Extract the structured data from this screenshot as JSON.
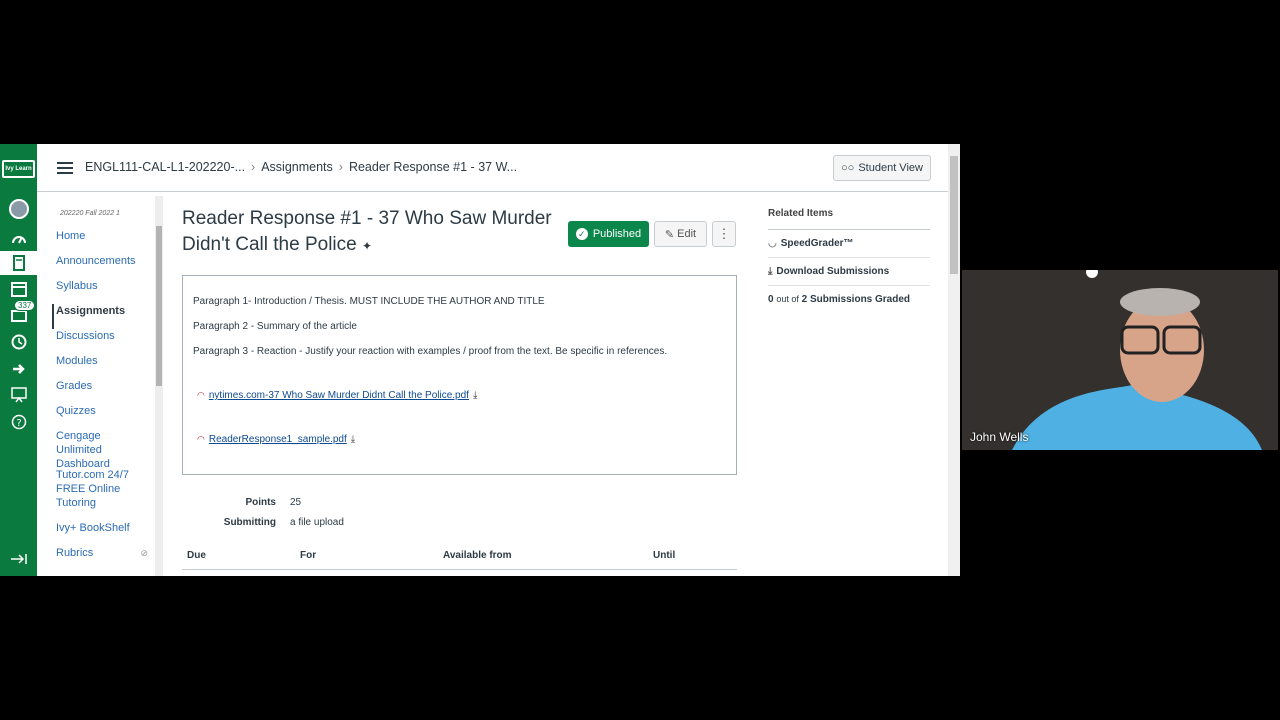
{
  "breadcrumbs": {
    "course": "ENGL111-CAL-L1-202220-...",
    "section": "Assignments",
    "page": "Reader Response #1 - 37 W..."
  },
  "header": {
    "student_view": "Student View"
  },
  "global_nav": {
    "logo": "Ivy Learn",
    "inbox_badge": "337"
  },
  "course_nav": {
    "term": "202220 Fall 2022 1",
    "items": [
      "Home",
      "Announcements",
      "Syllabus",
      "Assignments",
      "Discussions",
      "Modules",
      "Grades",
      "Quizzes",
      "Cengage Unlimited Dashboard",
      "Tutor.com 24/7 FREE Online Tutoring",
      "Ivy+ BookShelf",
      "Rubrics"
    ]
  },
  "assignment": {
    "title": "Reader Response #1 - 37 Who Saw Murder Didn't Call the Police",
    "published": "Published",
    "edit": "Edit",
    "paragraphs": [
      "Paragraph 1- Introduction / Thesis. MUST INCLUDE THE AUTHOR AND TITLE",
      "Paragraph 2 - Summary of the article",
      "Paragraph 3 - Reaction - Justify your reaction with examples / proof from the text. Be specific in references."
    ],
    "files": [
      "nytimes.com-37 Who Saw Murder Didnt Call the Police.pdf",
      "ReaderResponse1_sample.pdf"
    ],
    "points_label": "Points",
    "points": "25",
    "submitting_label": "Submitting",
    "submitting": "a file upload"
  },
  "dates_table": {
    "headers": [
      "Due",
      "For",
      "Available from",
      "Until"
    ]
  },
  "related": {
    "title": "Related Items",
    "speedgrader": "SpeedGrader™",
    "download": "Download Submissions",
    "graded_count": "0",
    "graded_of": "out of",
    "graded_total": "2 Submissions Graded"
  },
  "video": {
    "participant": "John Wells"
  },
  "colors": {
    "nav_green": "#0b7a3e",
    "published_green": "#0b874b",
    "link": "#2b6bb3"
  }
}
